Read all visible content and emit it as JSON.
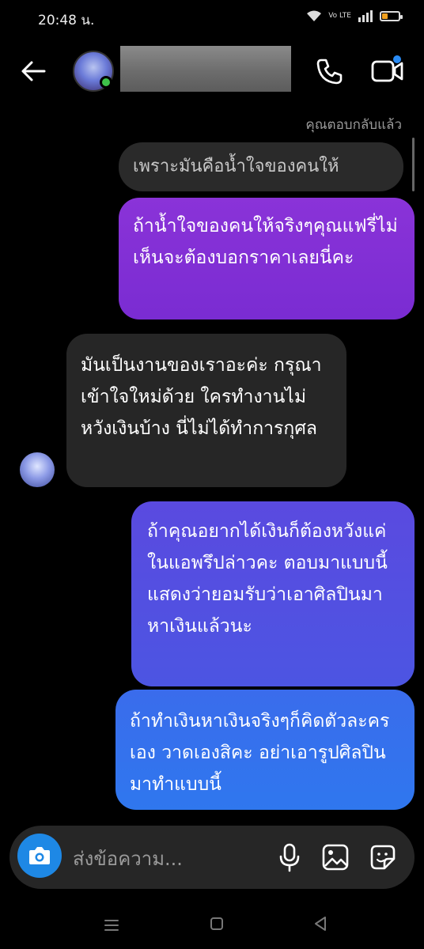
{
  "status_bar": {
    "time": "20:48 น.",
    "volte": "Vo LTE"
  },
  "header": {
    "contact_name": "",
    "icons": [
      "back-arrow-icon",
      "avatar",
      "phone-icon",
      "video-icon"
    ]
  },
  "conversation": {
    "reply_note": "คุณตอบกลับแล้ว",
    "quoted_message": "เพราะมันคือน้ำใจของคนให้",
    "messages": [
      {
        "sender": "me",
        "text": "ถ้าน้ำใจของคนให้จริงๆคุณแฟรี่ไม่เห็นจะต้องบอกราคาเลยนี่คะ"
      },
      {
        "sender": "other",
        "text": "มันเป็นงานของเราอะค่ะ กรุณาเข้าใจใหม่ด้วย ใครทำงานไม่หวังเงินบ้าง นี่ไม่ได้ทำการกุศล"
      },
      {
        "sender": "me",
        "text": "ถ้าคุณอยากได้เงินก็ต้องหวังแค่ในแอพรึปล่าวคะ ตอบมาแบบนี้แสดงว่ายอมรับว่าเอาศิลปินมาหาเงินแล้วนะ"
      },
      {
        "sender": "me",
        "text": "ถ้าทำเงินหาเงินจริงๆก็คิดตัวละครเอง วาดเองสิคะ อย่าเอารูปศิลปินมาทำแบบนี้"
      }
    ]
  },
  "composer": {
    "placeholder": "ส่งข้อความ..."
  },
  "colors": {
    "purple": "#8a33d8",
    "indigo": "#5a4ae0",
    "blue": "#3a6cec",
    "gray": "#262626",
    "camera": "#1e88e5",
    "online": "#3ec14a"
  }
}
